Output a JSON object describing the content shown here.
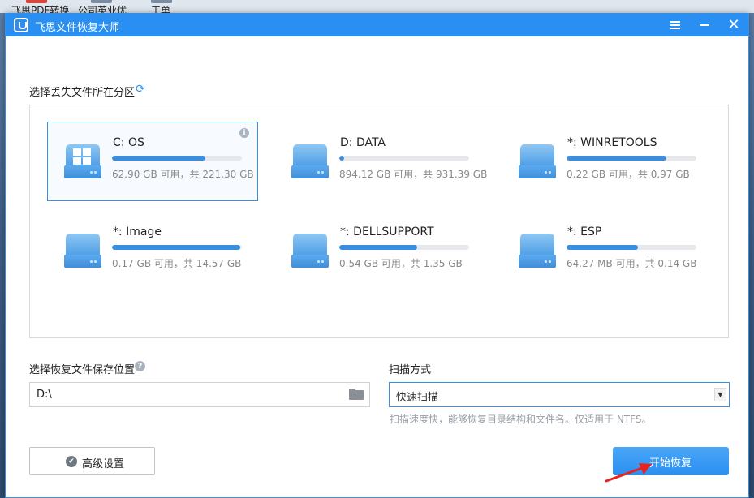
{
  "desktop": {
    "icon_labels": [
      "飞思PDF转换",
      "公司英业优",
      "工单"
    ]
  },
  "window": {
    "title": "飞思文件恢复大师",
    "controls": {
      "menu": "menu-icon",
      "minimize": "minimize-icon",
      "close": "close-icon"
    }
  },
  "partition_section": {
    "title": "选择丢失文件所在分区",
    "drives": [
      {
        "name": "C: OS",
        "info": "62.90 GB 可用，共 221.30 GB",
        "used_fraction": 0.72,
        "selected": true,
        "system": true
      },
      {
        "name": "D: DATA",
        "info": "894.12 GB 可用，共 931.39 GB",
        "used_fraction": 0.04,
        "selected": false,
        "system": false
      },
      {
        "name": "*: WINRETOOLS",
        "info": "0.22 GB 可用，共 0.97 GB",
        "used_fraction": 0.77,
        "selected": false,
        "system": false
      },
      {
        "name": "*: Image",
        "info": "0.17 GB 可用，共 14.57 GB",
        "used_fraction": 0.99,
        "selected": false,
        "system": false
      },
      {
        "name": "*: DELLSUPPORT",
        "info": "0.54 GB 可用，共 1.35 GB",
        "used_fraction": 0.6,
        "selected": false,
        "system": false
      },
      {
        "name": "*: ESP",
        "info": "64.27 MB 可用，共 0.14 GB",
        "used_fraction": 0.55,
        "selected": false,
        "system": false
      }
    ]
  },
  "save_section": {
    "title": "选择恢复文件保存位置",
    "path": "D:\\"
  },
  "scan_section": {
    "title": "扫描方式",
    "selected": "快速扫描",
    "hint": "扫描速度快，能够恢复目录结构和文件名。仅适用于 NTFS。"
  },
  "buttons": {
    "advanced": "高级设置",
    "start": "开始恢复"
  },
  "colors": {
    "accent": "#2a8ff3",
    "bar_fill": "#3a8ee0",
    "annotation_arrow": "#e8231c"
  }
}
